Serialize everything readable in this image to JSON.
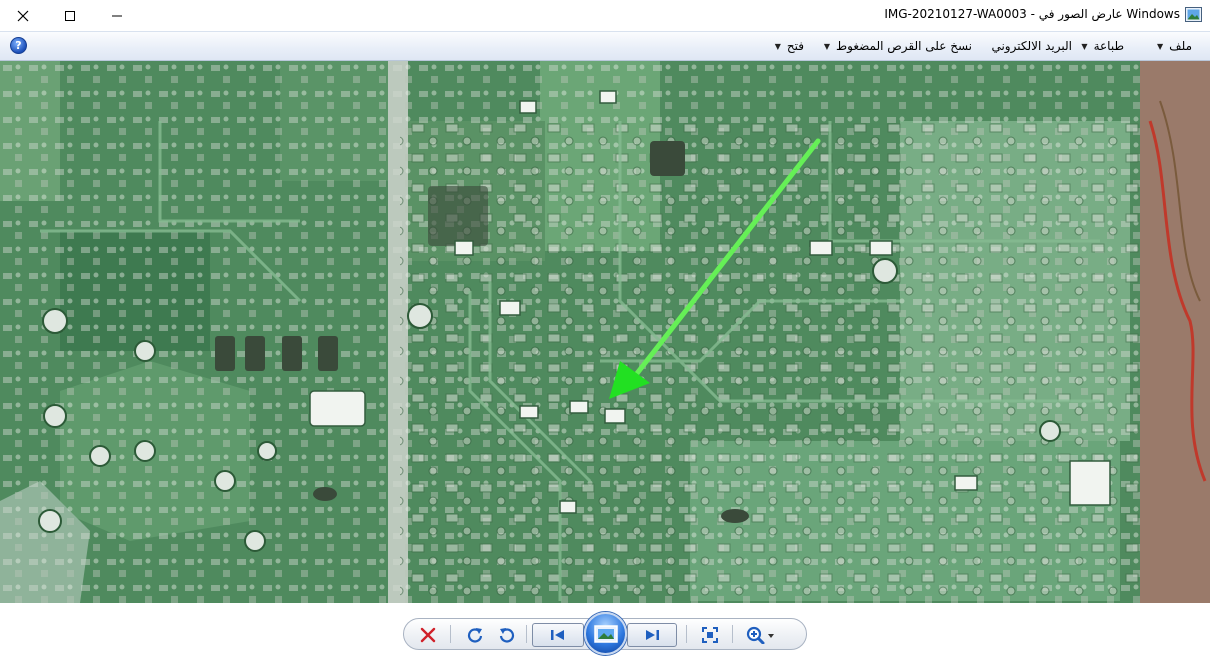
{
  "window": {
    "title": "IMG-20210127-WA0003 - عارض الصور في Windows",
    "app_icon": "photo-viewer-icon"
  },
  "menu": {
    "items": [
      {
        "label": "ملف",
        "has_dropdown": true
      },
      {
        "label": "طباعة",
        "has_dropdown": true
      },
      {
        "label": "البريد الالكتروني",
        "has_dropdown": false
      },
      {
        "label": "نسخ على القرص المضغوط",
        "has_dropdown": true
      },
      {
        "label": "فتح",
        "has_dropdown": true
      }
    ],
    "help_icon": "help-icon",
    "help_label": "?"
  },
  "toolbar": {
    "buttons": [
      {
        "name": "delete-button",
        "icon": "red-x-icon"
      },
      {
        "name": "rotate-clockwise-button",
        "icon": "rotate-cw-icon"
      },
      {
        "name": "rotate-counterclockwise-button",
        "icon": "rotate-ccw-icon"
      },
      {
        "name": "previous-button",
        "icon": "skip-back-icon"
      },
      {
        "name": "slideshow-button",
        "icon": "slideshow-icon"
      },
      {
        "name": "next-button",
        "icon": "skip-forward-icon"
      },
      {
        "name": "actual-size-button",
        "icon": "fit-window-icon"
      },
      {
        "name": "zoom-button",
        "icon": "magnifier-plus-icon"
      }
    ]
  },
  "image": {
    "subject": "circuit-board-photo",
    "annotation": "green-arrow-icon"
  },
  "colors": {
    "pcb_green": "#4f8a5e",
    "trace_green": "#6fa57a",
    "arrow": "#22ee22",
    "delete_red": "#d0202a",
    "toolbar_blue": "#1f5fbf"
  }
}
